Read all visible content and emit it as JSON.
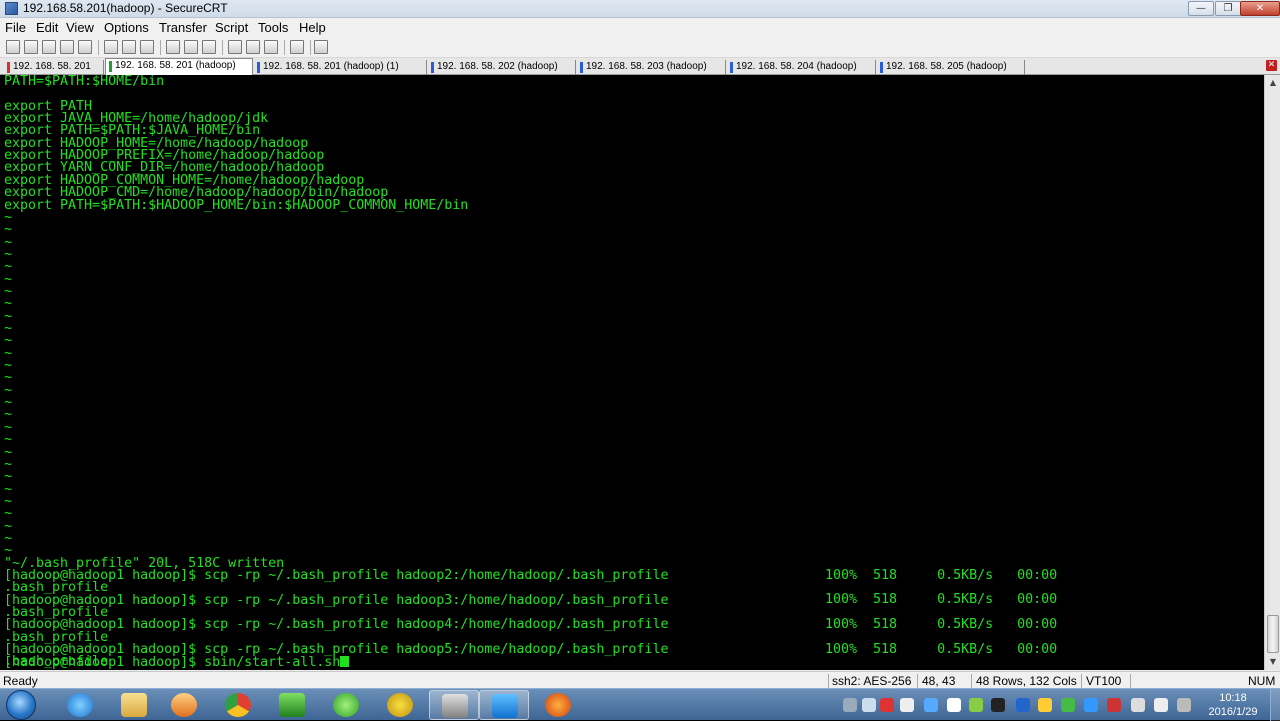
{
  "window": {
    "title": "192.168.58.201(hadoop) - SecureCRT"
  },
  "menu": [
    "File",
    "Edit",
    "View",
    "Options",
    "Transfer",
    "Script",
    "Tools",
    "Help"
  ],
  "tabs": [
    {
      "label": "192. 168. 58. 201",
      "active": false
    },
    {
      "label": "192. 168. 58. 201 (hadoop)",
      "active": true
    },
    {
      "label": "192. 168. 58. 201 (hadoop)   (1)",
      "active": false
    },
    {
      "label": "192. 168. 58. 202 (hadoop)",
      "active": false
    },
    {
      "label": "192. 168. 58. 203 (hadoop)",
      "active": false
    },
    {
      "label": "192. 168. 58. 204 (hadoop)",
      "active": false
    },
    {
      "label": "192. 168. 58. 205 (hadoop)",
      "active": false
    }
  ],
  "terminal": {
    "lines": [
      "PATH=$PATH:$HOME/bin",
      "",
      "export PATH",
      "export JAVA_HOME=/home/hadoop/jdk",
      "export PATH=$PATH:$JAVA_HOME/bin",
      "export HADOOP_HOME=/home/hadoop/hadoop",
      "export HADOOP_PREFIX=/home/hadoop/hadoop",
      "export YARN_CONF_DIR=/home/hadoop/hadoop",
      "export HADOOP_COMMON_HOME=/home/hadoop/hadoop",
      "export HADOOP_CMD=/home/hadoop/hadoop/bin/hadoop",
      "export PATH=$PATH:$HADOOP_HOME/bin:$HADOOP_COMMON_HOME/bin",
      "~",
      "~",
      "~",
      "~",
      "~",
      "~",
      "~",
      "~",
      "~",
      "~",
      "~",
      "~",
      "~",
      "~",
      "~",
      "~",
      "~",
      "~",
      "~",
      "~",
      "~",
      "~",
      "~",
      "~",
      "~",
      "~",
      "~",
      "~",
      "\"~/.bash_profile\" 20L, 518C written",
      "[hadoop@hadoop1 hadoop]$ scp -rp ~/.bash_profile hadoop2:/home/hadoop/.bash_profile",
      ".bash_profile",
      "[hadoop@hadoop1 hadoop]$ scp -rp ~/.bash_profile hadoop3:/home/hadoop/.bash_profile",
      ".bash_profile",
      "[hadoop@hadoop1 hadoop]$ scp -rp ~/.bash_profile hadoop4:/home/hadoop/.bash_profile",
      ".bash_profile",
      "[hadoop@hadoop1 hadoop]$ scp -rp ~/.bash_profile hadoop5:/home/hadoop/.bash_profile",
      ".bash_profile"
    ],
    "prompt_line": "[hadoop@hadoop1 hadoop]$ sbin/start-all.sh",
    "scp_stats": [
      "100%  518     0.5KB/s   00:00",
      "100%  518     0.5KB/s   00:00",
      "100%  518     0.5KB/s   00:00",
      "100%  518     0.5KB/s   00:00"
    ]
  },
  "status": {
    "ready": "Ready",
    "cipher": "ssh2: AES-256",
    "cursor_pos": "48, 43",
    "size": "48 Rows, 132 Cols",
    "emulation": "VT100",
    "numlock": "NUM"
  },
  "clock": {
    "time": "10:18",
    "date": "2016/1/29"
  },
  "colors": {
    "terminal_fg": "#20e020",
    "terminal_bg": "#000000"
  }
}
